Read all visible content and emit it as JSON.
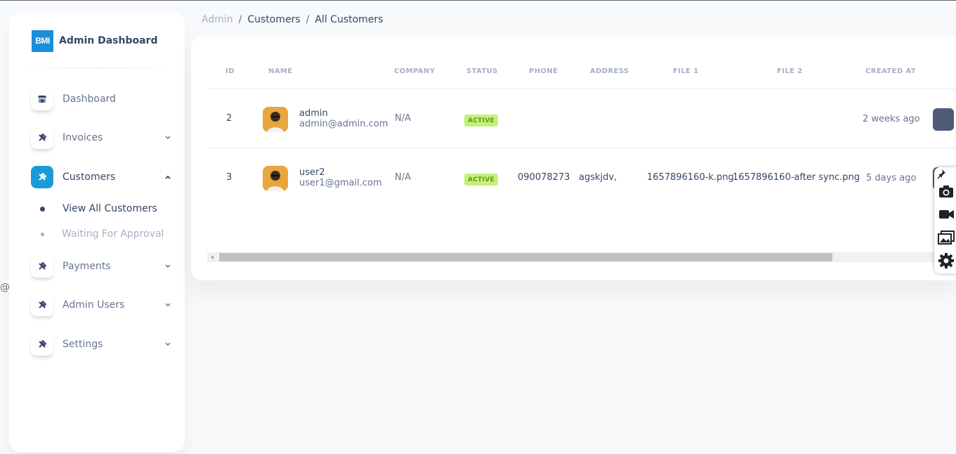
{
  "stray_text": "@",
  "brand": {
    "logo_text": "BMI",
    "name": "Admin Dashboard"
  },
  "sidebar": {
    "items": [
      {
        "label": "Dashboard",
        "icon": "shop-icon"
      },
      {
        "label": "Invoices",
        "icon": "tools-icon"
      },
      {
        "label": "Customers",
        "icon": "tools-icon",
        "active": true
      },
      {
        "label": "Payments",
        "icon": "tools-icon"
      },
      {
        "label": "Admin Users",
        "icon": "tools-icon"
      },
      {
        "label": "Settings",
        "icon": "tools-icon"
      }
    ],
    "sub_items": [
      {
        "label": "View All Customers",
        "active": true
      },
      {
        "label": "Waiting For Approval",
        "active": false
      }
    ]
  },
  "breadcrumb": {
    "root": "Admin",
    "sep": "/",
    "parent": "Customers",
    "current": "All Customers"
  },
  "table": {
    "columns": [
      "ID",
      "NAME",
      "COMPANY",
      "STATUS",
      "PHONE",
      "ADDRESS",
      "FILE 1",
      "FILE 2",
      "CREATED AT"
    ],
    "rows": [
      {
        "id": "2",
        "name": "admin",
        "email": "admin@admin.com",
        "company": "N/A",
        "status": "ACTIVE",
        "phone": "",
        "address": "",
        "file1": "",
        "file2": "",
        "created_at": "2 weeks ago"
      },
      {
        "id": "3",
        "name": "user2",
        "email": "user1@gmail.com",
        "company": "N/A",
        "status": "ACTIVE",
        "phone": "090078273",
        "address": "agskjdv,",
        "file1": "1657896160-k.png",
        "file2": "1657896160-after sync.png",
        "created_at": "5 days ago"
      }
    ]
  },
  "colors": {
    "accent": "#1a9bd9",
    "badge_bg": "#c5f07a",
    "badge_text": "#5a9e0f"
  },
  "floating_toolbar": {
    "icons": [
      "pin-icon",
      "camera-icon",
      "video-icon",
      "gallery-icon",
      "settings-gear-icon"
    ]
  }
}
